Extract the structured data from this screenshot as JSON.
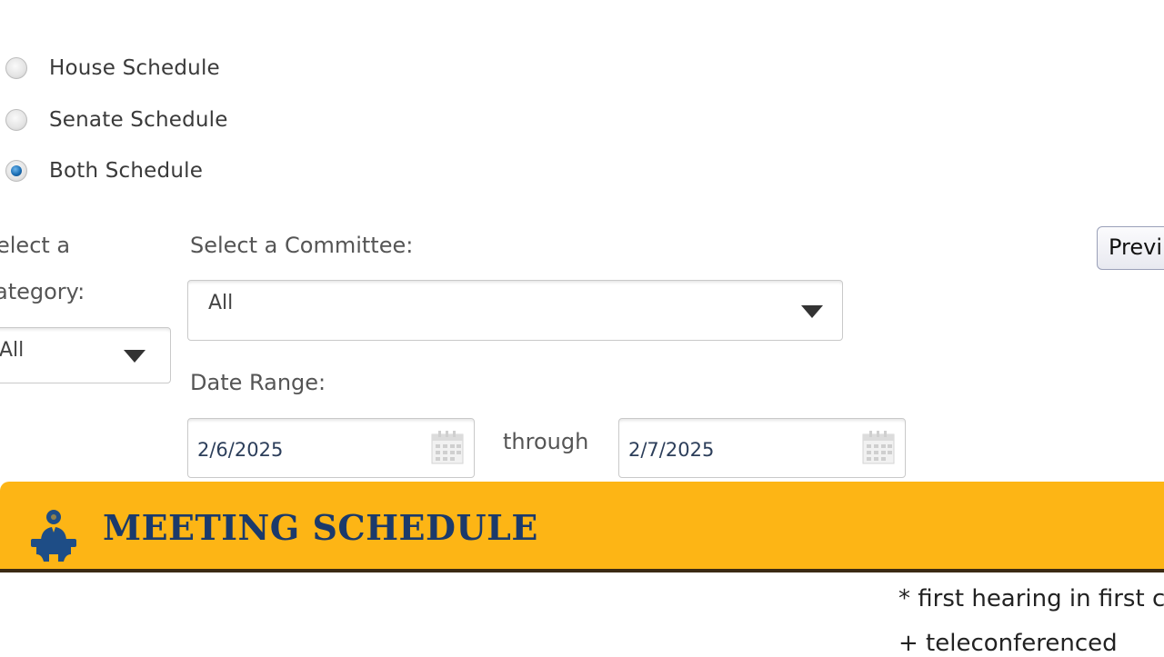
{
  "schedule_options": {
    "house": {
      "label": "House Schedule",
      "checked": false
    },
    "senate": {
      "label": "Senate Schedule",
      "checked": false
    },
    "both": {
      "label": "Both Schedule",
      "checked": true
    }
  },
  "category": {
    "label_line1": "elect a",
    "label_line2": "ategory:",
    "value": "All"
  },
  "committee": {
    "label": "Select a Committee:",
    "value": "All"
  },
  "date_range": {
    "label": "Date Range:",
    "start": "2/6/2025",
    "separator": "through",
    "end": "2/7/2025"
  },
  "preview_button": {
    "label": "Previ"
  },
  "banner": {
    "title": "MEETING SCHEDULE",
    "icon": "speaker-podium-icon",
    "color": "#fdb515",
    "title_color": "#1b3a6b"
  },
  "legend": {
    "first_hearing": "* first hearing in first c",
    "teleconferenced": "+ teleconferenced"
  }
}
